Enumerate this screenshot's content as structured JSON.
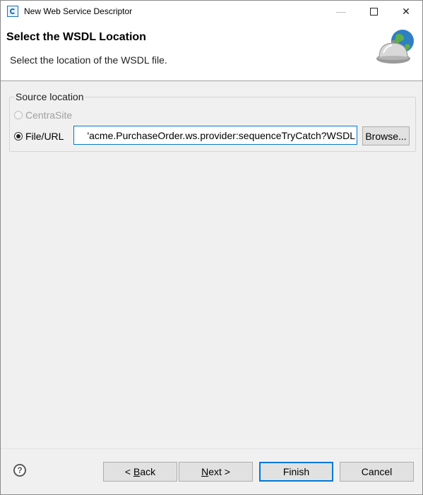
{
  "window": {
    "title": "New Web Service Descriptor",
    "minimize_glyph": "—",
    "close_glyph": "✕"
  },
  "header": {
    "title": "Select the WSDL Location",
    "description": "Select the location of the WSDL file.",
    "graphic_icon": "globe-service-bell-icon"
  },
  "source_location": {
    "group_label": "Source location",
    "options": [
      {
        "label": "CentraSite",
        "selected": false,
        "enabled": false
      },
      {
        "label": "File/URL",
        "selected": true,
        "enabled": true
      }
    ],
    "url_value": "'acme.PurchaseOrder.ws.provider:sequenceTryCatch?WSDL",
    "browse_label": "Browse..."
  },
  "footer": {
    "help_glyph": "?",
    "back": {
      "pre": "< ",
      "mnemonic": "B",
      "rest": "ack"
    },
    "next": {
      "mnemonic": "N",
      "rest": "ext >"
    },
    "finish_label": "Finish",
    "cancel_label": "Cancel"
  },
  "colors": {
    "focus_blue": "#0078d7",
    "button_face": "#e1e1e1",
    "dialog_background": "#f0f0f0"
  }
}
